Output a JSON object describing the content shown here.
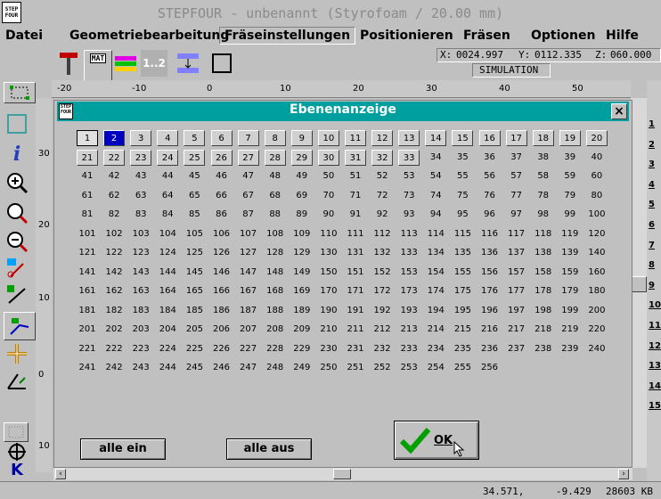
{
  "titlebar": {
    "icon_text": "STEP FOUR",
    "title": "STEPFOUR - unbenannt (Styrofoam / 20.00 mm)"
  },
  "menu": {
    "items": [
      "Datei",
      "Geometriebearbeitung",
      "Fräseinstellungen",
      "Positionieren",
      "Fräsen",
      "Optionen",
      "Hilfe"
    ],
    "active": "Fräseinstellungen"
  },
  "toolbar": {
    "mat_label": "MAT",
    "layer_label": "1..2",
    "coord_x_label": "X:",
    "coord_x": "0024.997",
    "coord_y_label": "Y:",
    "coord_y": "0112.335",
    "coord_z_label": "Z:",
    "coord_z": "060.000",
    "mode": "SIMULATION"
  },
  "ruler": {
    "ticks": [
      "-20",
      "-10",
      "0",
      "10",
      "20",
      "30",
      "40",
      "50"
    ]
  },
  "vruler": {
    "ticks": [
      "30",
      "20",
      "10",
      "0",
      "10"
    ]
  },
  "right_numbers": [
    "1",
    "2",
    "3",
    "4",
    "5",
    "6",
    "7",
    "8",
    "9",
    "10",
    "11",
    "12",
    "13",
    "14",
    "15"
  ],
  "dialog": {
    "title": "Ebenenanzeige",
    "icon_text": "STEP FOUR",
    "close": "×",
    "selected_layer": 2,
    "layer_count": 256,
    "button_layers": 33,
    "btn_all_on": "alle ein",
    "btn_all_off": "alle aus",
    "btn_ok": "OK"
  },
  "status": {
    "x": "34.571,",
    "y": "-9.429",
    "mem": "28603 KB"
  },
  "colors": {
    "dialog_title": "#009f9f",
    "selected_cell": "#0000c0",
    "window": "#c0c0c0"
  }
}
